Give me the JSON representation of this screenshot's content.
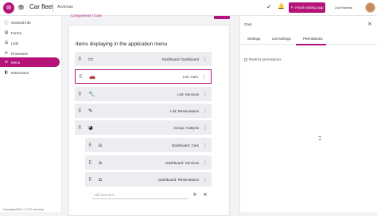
{
  "header": {
    "logo": "≡",
    "app_icon": "⛃",
    "title": "Car fleet",
    "workspace": "Archman",
    "finish_label": "Finish editing app",
    "user_name": "Zoe Roberts"
  },
  "sidebar": {
    "items": [
      {
        "label": "General info",
        "icon": "ⓘ"
      },
      {
        "label": "Forms",
        "icon": "▤"
      },
      {
        "label": "Lists",
        "icon": "☰"
      },
      {
        "label": "Processes",
        "icon": "⟳"
      },
      {
        "label": "Menu",
        "icon": "≡"
      },
      {
        "label": "Extensions",
        "icon": "◧"
      }
    ],
    "version": "Navigator365 1.0.122-develop"
  },
  "main": {
    "breadcrumb": "Components / Cars",
    "title": "Items displaying in the application menu",
    "items": [
      {
        "label": "Dashboard: Dashboard",
        "icon": "▭"
      },
      {
        "label": "List: Cars",
        "icon": "🚗"
      },
      {
        "label": "List: Services",
        "icon": "🔧"
      },
      {
        "label": "List: Reservations",
        "icon": "✎"
      },
      {
        "label": "Group: Analysis",
        "icon": "◕"
      },
      {
        "label": "Dashboard: Cars",
        "icon": "⌂"
      },
      {
        "label": "Dashboard: Services",
        "icon": "⌂"
      },
      {
        "label": "Dashboard: Reservations",
        "icon": "⌂"
      }
    ],
    "new_item_placeholder": "Add new item"
  },
  "panel": {
    "title": "Cars",
    "tabs": [
      "Settings",
      "List settings",
      "Permissions"
    ],
    "restrict_label": "Restrict permissions"
  },
  "colors": {
    "accent": "#b5127a"
  }
}
